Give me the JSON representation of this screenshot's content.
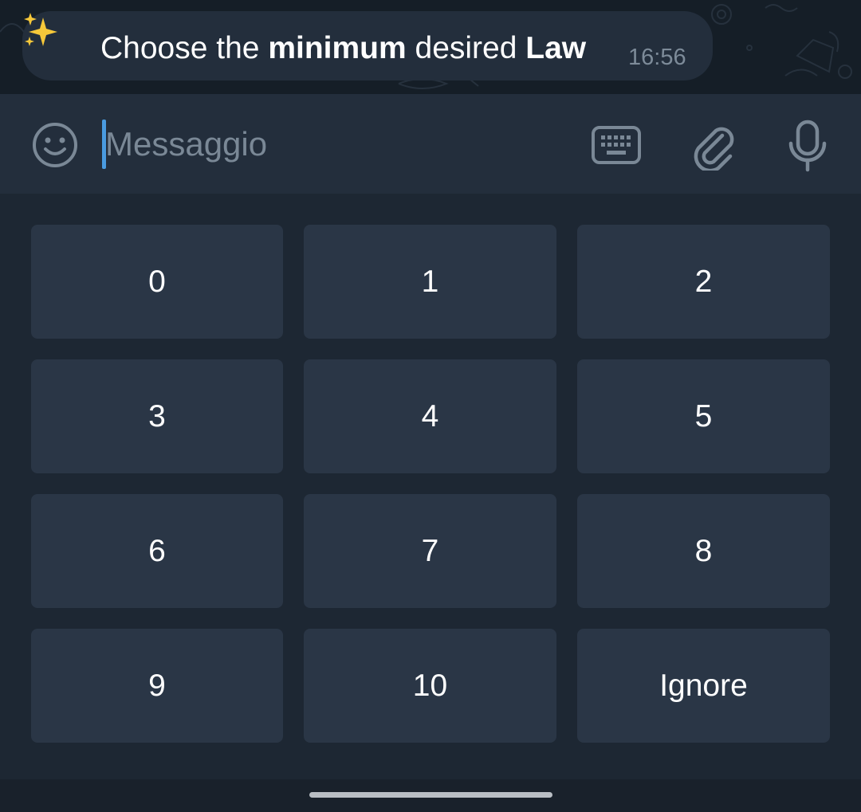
{
  "message": {
    "emoji": "✨",
    "text_parts": [
      {
        "text": "Choose the ",
        "bold": false
      },
      {
        "text": "minimum",
        "bold": true
      },
      {
        "text": " desired ",
        "bold": false
      },
      {
        "text": "Law",
        "bold": true
      }
    ],
    "time": "16:56"
  },
  "composer": {
    "placeholder": "Messaggio",
    "value": "",
    "icons": {
      "emoji": "smiley-icon",
      "keyboard": "keyboard-icon",
      "attach": "paperclip-icon",
      "voice": "microphone-icon"
    }
  },
  "reply_keyboard": {
    "buttons": [
      "0",
      "1",
      "2",
      "3",
      "4",
      "5",
      "6",
      "7",
      "8",
      "9",
      "10",
      "Ignore"
    ]
  },
  "colors": {
    "chat_background": "#151e27",
    "bubble": "#232e3c",
    "panel": "#1d2733",
    "key": "#2a3646",
    "cursor": "#4a9be0",
    "muted_text": "#7d8b99"
  }
}
